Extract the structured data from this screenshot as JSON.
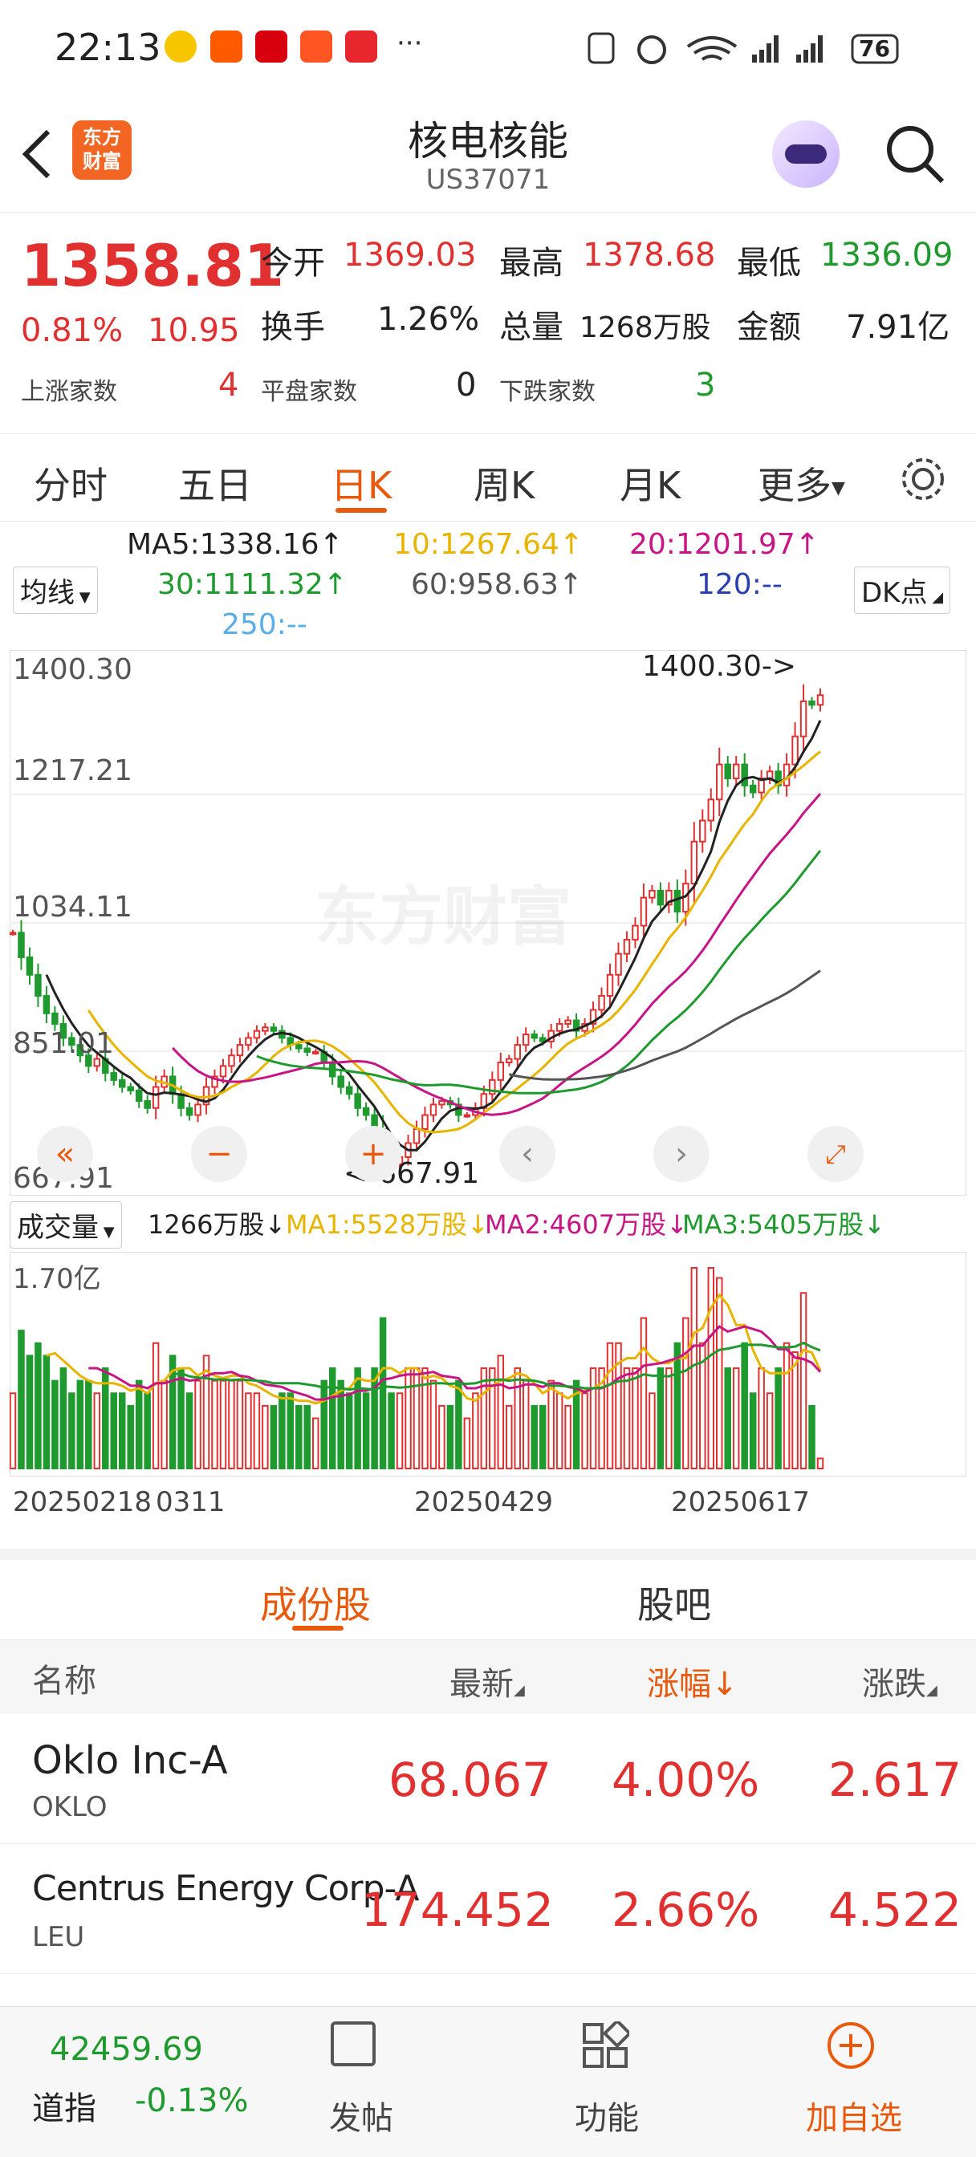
{
  "status_bar": {
    "time": "22:13",
    "battery": "76",
    "ellipsis": "···"
  },
  "header": {
    "title": "核电核能",
    "code": "US37071",
    "logo_text": "东方\n财富"
  },
  "quote": {
    "price": "1358.81",
    "change_pct": "0.81%",
    "change": "10.95",
    "open_label": "今开",
    "open": "1369.03",
    "high_label": "最高",
    "high": "1378.68",
    "low_label": "最低",
    "low": "1336.09",
    "turnover_label": "换手",
    "turnover": "1.26%",
    "volume_label": "总量",
    "volume": "1268万股",
    "amount_label": "金额",
    "amount": "7.91亿",
    "up_label": "上涨家数",
    "up": "4",
    "flat_label": "平盘家数",
    "flat": "0",
    "down_label": "下跌家数",
    "down": "3"
  },
  "tabs": [
    "分时",
    "五日",
    "日K",
    "周K",
    "月K",
    "更多"
  ],
  "active_tab": "日K",
  "ma": {
    "selector": "均线",
    "ma5": "MA5:1338.16↑",
    "ma10": "10:1267.64↑",
    "ma20": "20:1201.97↑",
    "ma30": "30:1111.32↑",
    "ma60": "60:958.63↑",
    "ma120": "120:--",
    "ma250": "250:--",
    "dk": "DK点",
    "colors": {
      "ma5": "#222222",
      "ma10": "#e8b400",
      "ma20": "#c71585",
      "ma30": "#1e9a2e",
      "ma60": "#555555",
      "ma120": "#2a3fb0",
      "ma250": "#5aaee8"
    }
  },
  "chart_data": {
    "type": "candlestick",
    "y_labels": [
      "1400.30",
      "1217.21",
      "1034.11",
      "851.01",
      "667.91"
    ],
    "max_label": "1400.30->",
    "min_label": "<-667.91",
    "ylim": [
      667.91,
      1400.3
    ],
    "x_ticks": [
      "20250218",
      "0311",
      "20250429",
      "20250617"
    ],
    "watermark": "东方财富",
    "closes": [
      1020,
      985,
      960,
      930,
      905,
      890,
      870,
      860,
      845,
      830,
      840,
      820,
      810,
      800,
      795,
      780,
      770,
      800,
      815,
      790,
      770,
      760,
      775,
      800,
      815,
      830,
      845,
      860,
      870,
      880,
      885,
      880,
      870,
      860,
      855,
      850,
      850,
      835,
      815,
      800,
      790,
      770,
      760,
      740,
      700,
      690,
      700,
      720,
      740,
      760,
      775,
      780,
      775,
      760,
      760,
      770,
      790,
      810,
      835,
      840,
      860,
      875,
      870,
      865,
      880,
      890,
      895,
      880,
      890,
      910,
      930,
      960,
      990,
      1010,
      1030,
      1070,
      1080,
      1060,
      1080,
      1050,
      1090,
      1150,
      1180,
      1210,
      1260,
      1240,
      1260,
      1230,
      1220,
      1240,
      1250,
      1230,
      1260,
      1300,
      1350,
      1345,
      1358.81
    ]
  },
  "volume": {
    "selector": "成交量",
    "vol": "1266万股↓",
    "ma1": "MA1:5528万股↓",
    "ma2": "MA2:4607万股↓",
    "ma3": "MA3:5405万股↓",
    "top_label": "1.70亿"
  },
  "sub_tabs": [
    "成份股",
    "股吧"
  ],
  "table": {
    "headers": [
      "名称",
      "最新",
      "涨幅↓",
      "涨跌"
    ],
    "rows": [
      {
        "name": "Oklo Inc-A",
        "code": "OKLO",
        "price": "68.067",
        "pct": "4.00%",
        "chg": "2.617"
      },
      {
        "name": "Centrus Energy Corp-A",
        "code": "LEU",
        "price": "174.452",
        "pct": "2.66%",
        "chg": "4.522"
      }
    ]
  },
  "bottom_nav": {
    "index_value": "42459.69",
    "index_name": "道指",
    "index_change": "-0.13%",
    "items": [
      "发帖",
      "功能",
      "加自选"
    ]
  }
}
